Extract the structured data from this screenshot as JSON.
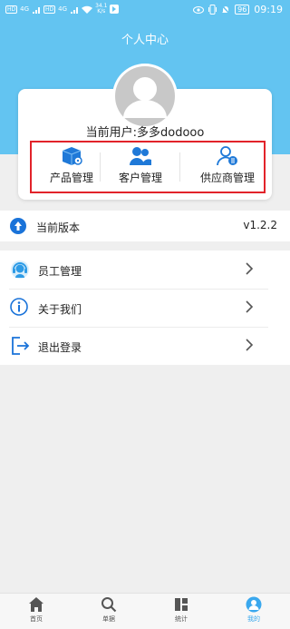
{
  "status_bar": {
    "net_tag_1": "HD",
    "net_tag_2": "HD",
    "signal_1": "4G",
    "signal_2": "4G",
    "speed_value": "34.1",
    "speed_unit": "K/s",
    "battery": "96",
    "time": "09:19"
  },
  "header": {
    "title": "个人中心"
  },
  "user": {
    "name_line": "当前用户:多多dodooo"
  },
  "quick_actions": [
    {
      "label": "产品管理",
      "icon": "product-box-icon"
    },
    {
      "label": "客户管理",
      "icon": "customers-icon"
    },
    {
      "label": "供应商管理",
      "icon": "supplier-icon"
    }
  ],
  "version": {
    "label": "当前版本",
    "value": "v1.2.2"
  },
  "menu": [
    {
      "label": "员工管理",
      "icon": "staff-headset-icon"
    },
    {
      "label": "关于我们",
      "icon": "info-icon"
    },
    {
      "label": "退出登录",
      "icon": "logout-icon"
    }
  ],
  "tabbar": {
    "active": "我的",
    "tabs": [
      {
        "label": "首页",
        "icon": "home-icon"
      },
      {
        "label": "单据",
        "icon": "search-icon"
      },
      {
        "label": "统计",
        "icon": "stats-icon"
      },
      {
        "label": "我的",
        "icon": "profile-icon"
      }
    ]
  },
  "colors": {
    "header_bg": "#63c4f1",
    "accent": "#1a73d9",
    "highlight_border": "#e2232a",
    "active_tab": "#3aa8ee"
  }
}
